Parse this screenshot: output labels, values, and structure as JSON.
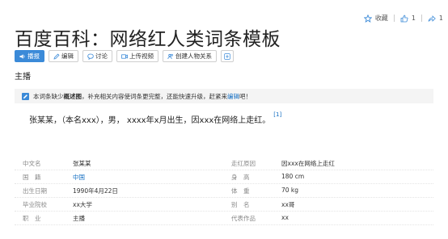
{
  "stats": {
    "favorite_label": "收藏",
    "likes": "1",
    "shares": "1"
  },
  "title": "百度百科：网络红人类词条模板",
  "toolbar": {
    "play": "播报",
    "edit": "编辑",
    "discuss": "讨论",
    "upload_video": "上传视频",
    "create_relation": "创建人物关系"
  },
  "subtitle": "主播",
  "notice": {
    "prefix": "本词条缺少",
    "bold": "概述图",
    "middle": "，补充相关内容使词条更完整，还能快速升级，赶紧来",
    "link": "编辑",
    "suffix": "吧！"
  },
  "summary": {
    "text": "张某某，（本名xxx），男， xxxx年x月出生，因xxx在网络上走红。",
    "ref": "[1]"
  },
  "infobox": {
    "left": [
      {
        "label": "中文名",
        "value": "张某某",
        "link": false
      },
      {
        "label": "国　籍",
        "value": "中国",
        "link": true
      },
      {
        "label": "出生日期",
        "value": "1990年4月22日",
        "link": false
      },
      {
        "label": "毕业院校",
        "value": "xx大学",
        "link": false
      },
      {
        "label": "职　业",
        "value": "主播",
        "link": false
      }
    ],
    "right": [
      {
        "label": "走红原因",
        "value": "因xxx在网络上走红",
        "link": false
      },
      {
        "label": "身　高",
        "value": "180 cm",
        "link": false
      },
      {
        "label": "体　重",
        "value": "70 kg",
        "link": false
      },
      {
        "label": "别　名",
        "value": "xx哥",
        "link": false
      },
      {
        "label": "代表作品",
        "value": "xx",
        "link": false
      }
    ]
  },
  "colors": {
    "accent": "#3b8ad8",
    "link": "#136ec2"
  },
  "icons": [
    "star-icon",
    "thumbs-up-icon",
    "share-icon",
    "speaker-icon",
    "pencil-icon",
    "comment-icon",
    "video-icon",
    "people-icon",
    "plus-icon",
    "edit-notice-icon"
  ]
}
